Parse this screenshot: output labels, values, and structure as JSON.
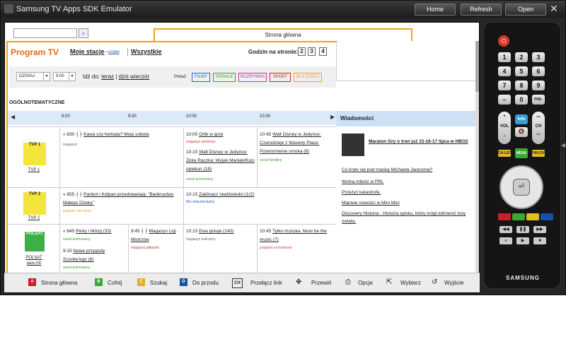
{
  "window": {
    "title": "Samsung TV Apps SDK Emulator",
    "buttons": [
      "Home",
      "Refresh",
      "Open"
    ],
    "close_glyph": "✕"
  },
  "tab": {
    "title": "Strona główna"
  },
  "guide": {
    "title": "Program TV",
    "nav_my": "Moje stacje",
    "nav_dash": "-",
    "nav_ustaw": "ustaw",
    "nav_all": "Wszystkie",
    "hours_label": "Godzin na stronie:",
    "hours": [
      "2",
      "3",
      "4"
    ],
    "day": "DZISIAJ",
    "time": "9:00",
    "goto_label": "Idź do:",
    "goto_now": "teraz",
    "goto_sep": "|",
    "goto_evening": "dziś wieczór",
    "show_label": "Pokaż:",
    "filters": [
      {
        "label": "FILMY",
        "color": "#2266cc"
      },
      {
        "label": "SERIALE",
        "color": "#44a030"
      },
      {
        "label": "ROZRYWKA",
        "color": "#cc3399"
      },
      {
        "label": "SPORT",
        "color": "#cc2020"
      },
      {
        "label": "DLA DZIECI",
        "color": "#e8a020"
      }
    ],
    "category": "OGÓLNOTEMATYCZNE",
    "times": [
      "9:00",
      "9:30",
      "10:00",
      "10:30"
    ],
    "channels": [
      {
        "name": "TVP 1",
        "logo": "TVP 1",
        "logo_color": "#f3e53c",
        "programs": [
          {
            "time": "« 830",
            "title": "Kawa czy herbata? Moja sobota",
            "genre": "magazyn"
          },
          {
            "time": "10:05",
            "title": "Orlik w grze",
            "genre": "magazyn sportowy"
          },
          {
            "time": "10:15",
            "title": "Walt Disney w Jedynce: Złota Rączka: Wujek Maniek/Koci opiekun (18)",
            "genre": "serial animowany"
          },
          {
            "time": "10:45",
            "title": "Walt Disney w Jedynce: Czarodzieje z Waverly Place: Poskromienie smoka (8)",
            "genre": "serial familijny"
          }
        ]
      },
      {
        "name": "TVP 2",
        "logo": "TVP 2",
        "logo_color": "#f3e53c",
        "programs": [
          {
            "time": "« 855",
            "title": "Pankot i Kotpan przedstawiają: \"Bankructwo Małego Dżeka\"",
            "genre": "program dla dzieci"
          },
          {
            "time": "10:15",
            "title": "Zaklinacz niedźwiedzi (1/2)",
            "genre": "film dokumentalny"
          }
        ]
      },
      {
        "name": "POLSAT",
        "sub": "także HD",
        "logo": "POLSAT",
        "logo_color": "#3cb046",
        "programs": [
          {
            "time": "« 845",
            "title": "Pinky i Mózg (33)",
            "genre": "serial animowany"
          },
          {
            "time": "9:15",
            "title": "Nowe przygody Scooby'ego (8)",
            "genre": "serial animowany"
          },
          {
            "time": "9:45",
            "title": "Magazyn Ligi Mistrzów",
            "genre": "magazyn piłkarski"
          },
          {
            "time": "10:15",
            "title": "Ewa gotuje (140)",
            "genre": "magazyn kulinarny"
          },
          {
            "time": "10:45",
            "title": "Tylko muzyka. Must be the music (7)",
            "genre": "program rozrywkowy"
          }
        ]
      }
    ]
  },
  "news": {
    "header": "Wiadomości",
    "featured": "Maraton Gry o tron już 15-16-17 lipca w HBO2",
    "items": [
      "Co kryło się pod maską Michaela Jacksona?",
      "Wolna miłość w PRL",
      "Przeżyć katastrofę.",
      "Majowe nowości w Mini Mini",
      "Discovery Historia - Historia spisku, który mógł odmienić losy świata."
    ]
  },
  "bottom_bar": [
    {
      "key": "A",
      "color": "#c8202a",
      "label": "Strona główna"
    },
    {
      "key": "B",
      "color": "#3aa832",
      "label": "Cofnij"
    },
    {
      "key": "C",
      "color": "#e0b020",
      "label": "Szukaj"
    },
    {
      "key": "D",
      "color": "#1a4fa8",
      "label": "Do przodu"
    },
    {
      "icon": "CH",
      "label": "Przełącz link"
    },
    {
      "icon": "✥",
      "label": "Przewiń"
    },
    {
      "icon": "⎙",
      "label": "Opcje"
    },
    {
      "icon": "⇱",
      "label": "Wybierz"
    },
    {
      "icon": "↺",
      "label": "Wyjście"
    }
  ],
  "remote": {
    "power_glyph": "⏻",
    "digits": [
      "1",
      "2",
      "3",
      "4",
      "5",
      "6",
      "7",
      "8",
      "9",
      "–",
      "0",
      "PRE-CH"
    ],
    "vol_plus": "+",
    "vol_label": "VOL",
    "vol_minus": "–",
    "ch_label": "CH",
    "info": "Info",
    "mute_glyph": "🔇",
    "ch_list": "CH.LIST",
    "menu": "MENU",
    "fav_ch": "FAV.CH",
    "brand": "SAMSUNG"
  }
}
